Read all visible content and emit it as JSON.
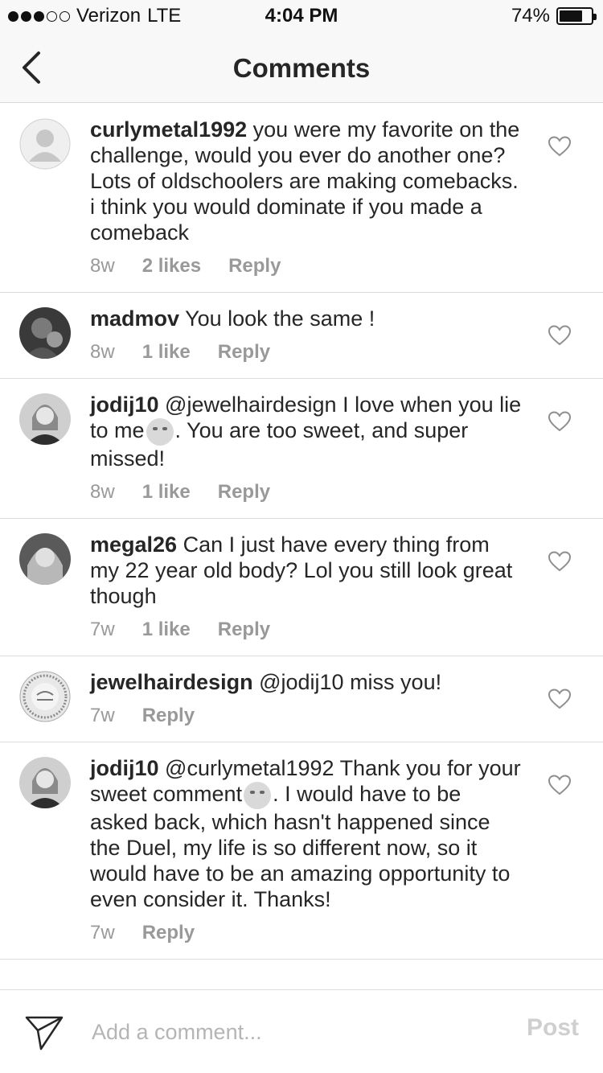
{
  "status_bar": {
    "carrier": "Verizon",
    "network": "LTE",
    "time": "4:04 PM",
    "battery": "74%",
    "battery_level": 0.74,
    "signal_bars": 3,
    "signal_max": 5
  },
  "nav": {
    "title": "Comments",
    "back_icon": "chevron-left-icon"
  },
  "comments": [
    {
      "username": "curlymetal1992",
      "text_before": "you were my favorite on the challenge, would you ever do another one? Lots of oldschoolers are making comebacks. i think you would dominate if you made a comeback",
      "emoji": "",
      "text_after": "",
      "time": "8w",
      "likes": "2 likes",
      "reply": "Reply",
      "avatar": "default-avatar-icon"
    },
    {
      "username": "madmov",
      "text_before": "You look the same !",
      "emoji": "",
      "text_after": "",
      "time": "8w",
      "likes": "1 like",
      "reply": "Reply",
      "avatar": "photo-avatar"
    },
    {
      "username": "jodij10",
      "text_before": "@jewelhairdesign I love when you lie to me",
      "emoji": "winking-face",
      "text_after": ". You are too sweet, and super missed!",
      "time": "8w",
      "likes": "1 like",
      "reply": "Reply",
      "avatar": "photo-avatar"
    },
    {
      "username": "megal26",
      "text_before": "Can I just have every thing from my 22 year old body? Lol you still look great though",
      "emoji": "",
      "text_after": "",
      "time": "7w",
      "likes": "1 like",
      "reply": "Reply",
      "avatar": "photo-avatar"
    },
    {
      "username": "jewelhairdesign",
      "text_before": "@jodij10 miss you!",
      "emoji": "",
      "text_after": "",
      "time": "7w",
      "likes": "",
      "reply": "Reply",
      "avatar": "logo-avatar"
    },
    {
      "username": "jodij10",
      "text_before": "@curlymetal1992 Thank you for your sweet comment",
      "emoji": "smiling-face",
      "text_after": ". I would have to be asked back, which hasn't happened since the Duel, my life is so different now, so it would have to be an amazing opportunity to even consider it.  Thanks!",
      "time": "7w",
      "likes": "",
      "reply": "Reply",
      "avatar": "photo-avatar"
    }
  ],
  "composer": {
    "placeholder": "Add a comment...",
    "post_label": "Post",
    "send_icon": "paper-plane-icon"
  },
  "colors": {
    "text": "#262626",
    "muted": "#999999",
    "divider": "#dcdcdc",
    "bar_bg": "#f8f8f8",
    "post_disabled": "#cfcfcf"
  }
}
